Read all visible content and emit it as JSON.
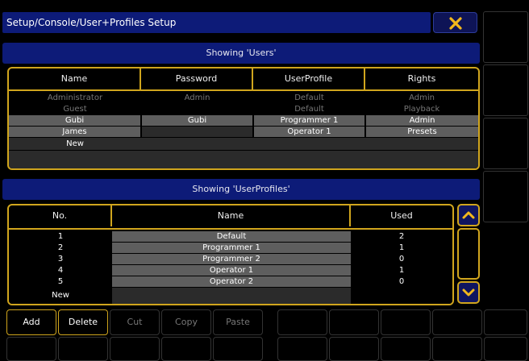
{
  "window": {
    "title": "Setup/Console/User+Profiles Setup",
    "close_icon": "close-x-icon",
    "accent_color": "#d0a51d",
    "header_color": "#0d1b78"
  },
  "users": {
    "section_title": "Showing 'Users'",
    "columns": [
      "Name",
      "Password",
      "UserProfile",
      "Rights"
    ],
    "rows": [
      {
        "name": "Administrator",
        "password": "Admin",
        "profile": "Default",
        "rights": "Admin"
      },
      {
        "name": "Guest",
        "password": "",
        "profile": "Default",
        "rights": "Playback"
      },
      {
        "name": "Gubi",
        "password": "Gubi",
        "profile": "Programmer 1",
        "rights": "Admin"
      },
      {
        "name": "James",
        "password": "",
        "profile": "Operator 1",
        "rights": "Presets"
      }
    ],
    "new_label": "New"
  },
  "profiles": {
    "section_title": "Showing 'UserProfiles'",
    "columns": [
      "No.",
      "Name",
      "Used"
    ],
    "rows": [
      {
        "no": "1",
        "name": "Default",
        "used": "2"
      },
      {
        "no": "2",
        "name": "Programmer 1",
        "used": "1"
      },
      {
        "no": "3",
        "name": "Programmer 2",
        "used": "0"
      },
      {
        "no": "4",
        "name": "Operator 1",
        "used": "1"
      },
      {
        "no": "5",
        "name": "Operator 2",
        "used": "0"
      }
    ],
    "new_label": "New",
    "scroll_up_icon": "chevron-up-icon",
    "scroll_down_icon": "chevron-down-icon"
  },
  "toolbar": {
    "add": "Add",
    "delete": "Delete",
    "cut": "Cut",
    "copy": "Copy",
    "paste": "Paste"
  }
}
